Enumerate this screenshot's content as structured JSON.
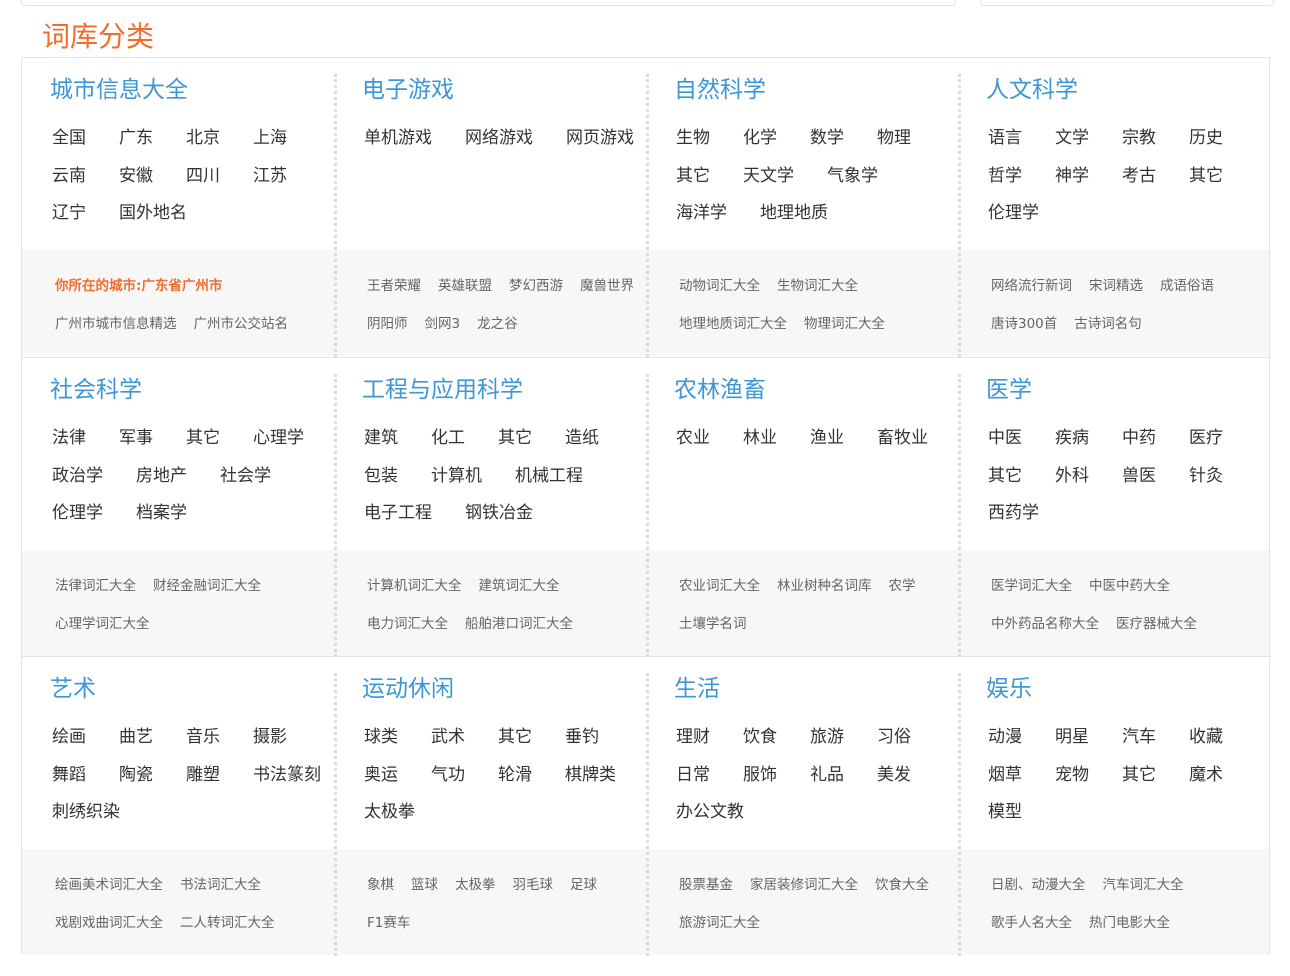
{
  "page": {
    "section_title": "词库分类"
  },
  "rows": [
    {
      "columns": [
        {
          "title": "城市信息大全",
          "links": [
            "全国",
            "广东",
            "北京",
            "上海",
            "云南",
            "安徽",
            "四川",
            "江苏",
            "辽宁",
            "国外地名"
          ],
          "sub_links": [
            "你所在的城市:广东省广州市",
            "广州市城市信息精选",
            "广州市公交站名"
          ]
        },
        {
          "title": "电子游戏",
          "links": [
            "单机游戏",
            "网络游戏",
            "网页游戏"
          ],
          "sub_links": [
            "王者荣耀",
            "英雄联盟",
            "梦幻西游",
            "魔兽世界",
            "阴阳师",
            "剑网3",
            "龙之谷"
          ]
        },
        {
          "title": "自然科学",
          "links": [
            "生物",
            "化学",
            "数学",
            "物理",
            "其它",
            "天文学",
            "气象学",
            "海洋学",
            "地理地质"
          ],
          "sub_links": [
            "动物词汇大全",
            "生物词汇大全",
            "地理地质词汇大全",
            "物理词汇大全"
          ]
        },
        {
          "title": "人文科学",
          "links": [
            "语言",
            "文学",
            "宗教",
            "历史",
            "哲学",
            "神学",
            "考古",
            "其它",
            "伦理学"
          ],
          "sub_links": [
            "网络流行新词",
            "宋词精选",
            "成语俗语",
            "唐诗300首",
            "古诗词名句"
          ]
        }
      ]
    },
    {
      "columns": [
        {
          "title": "社会科学",
          "links": [
            "法律",
            "军事",
            "其它",
            "心理学",
            "政治学",
            "房地产",
            "社会学",
            "伦理学",
            "档案学"
          ],
          "sub_links": [
            "法律词汇大全",
            "财经金融词汇大全",
            "心理学词汇大全"
          ]
        },
        {
          "title": "工程与应用科学",
          "links": [
            "建筑",
            "化工",
            "其它",
            "造纸",
            "包装",
            "计算机",
            "机械工程",
            "电子工程",
            "钢铁冶金"
          ],
          "sub_links": [
            "计算机词汇大全",
            "建筑词汇大全",
            "电力词汇大全",
            "船舶港口词汇大全"
          ]
        },
        {
          "title": "农林渔畜",
          "links": [
            "农业",
            "林业",
            "渔业",
            "畜牧业"
          ],
          "sub_links": [
            "农业词汇大全",
            "林业树种名词库",
            "农学",
            "土壤学名词"
          ]
        },
        {
          "title": "医学",
          "links": [
            "中医",
            "疾病",
            "中药",
            "医疗",
            "其它",
            "外科",
            "兽医",
            "针灸",
            "西药学"
          ],
          "sub_links": [
            "医学词汇大全",
            "中医中药大全",
            "中外药品名称大全",
            "医疗器械大全"
          ]
        }
      ]
    },
    {
      "columns": [
        {
          "title": "艺术",
          "links": [
            "绘画",
            "曲艺",
            "音乐",
            "摄影",
            "舞蹈",
            "陶瓷",
            "雕塑",
            "书法篆刻",
            "刺绣织染"
          ],
          "sub_links": [
            "绘画美术词汇大全",
            "书法词汇大全",
            "戏剧戏曲词汇大全",
            "二人转词汇大全"
          ]
        },
        {
          "title": "运动休闲",
          "links": [
            "球类",
            "武术",
            "其它",
            "垂钓",
            "奥运",
            "气功",
            "轮滑",
            "棋牌类",
            "太极拳"
          ],
          "sub_links": [
            "象棋",
            "篮球",
            "太极拳",
            "羽毛球",
            "足球",
            "F1赛车"
          ]
        },
        {
          "title": "生活",
          "links": [
            "理财",
            "饮食",
            "旅游",
            "习俗",
            "日常",
            "服饰",
            "礼品",
            "美发",
            "办公文教"
          ],
          "sub_links": [
            "股票基金",
            "家居装修词汇大全",
            "饮食大全",
            "旅游词汇大全"
          ]
        },
        {
          "title": "娱乐",
          "links": [
            "动漫",
            "明星",
            "汽车",
            "收藏",
            "烟草",
            "宠物",
            "其它",
            "魔术",
            "模型"
          ],
          "sub_links": [
            "日剧、动漫大全",
            "汽车词汇大全",
            "歌手人名大全",
            "热门电影大全"
          ]
        }
      ]
    }
  ],
  "highlight": {
    "sub_link_color": "#f06d2b",
    "title_color": "#3d97d6"
  }
}
